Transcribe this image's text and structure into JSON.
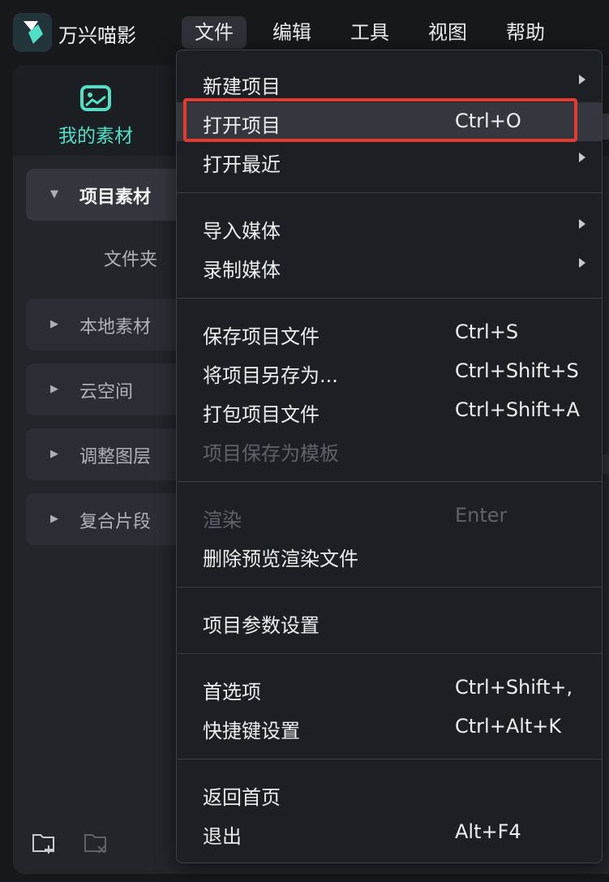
{
  "app": {
    "name": "万兴喵影"
  },
  "menubar": [
    {
      "label": "文件",
      "active": true
    },
    {
      "label": "编辑"
    },
    {
      "label": "工具"
    },
    {
      "label": "视图"
    },
    {
      "label": "帮助"
    }
  ],
  "left_panel": {
    "media_tab": "我的素材",
    "categories": [
      {
        "label": "项目素材"
      },
      {
        "label": "本地素材"
      },
      {
        "label": "云空间"
      },
      {
        "label": "调整图层"
      },
      {
        "label": "复合片段"
      }
    ],
    "subfolder": "文件夹"
  },
  "file_menu": {
    "items": [
      {
        "label": "新建项目",
        "submenu": true
      },
      {
        "label": "打开项目",
        "shortcut": "Ctrl+O",
        "highlighted": true
      },
      {
        "label": "打开最近",
        "submenu": true
      },
      {
        "label": "导入媒体",
        "submenu": true
      },
      {
        "label": "录制媒体",
        "submenu": true
      },
      {
        "label": "保存项目文件",
        "shortcut": "Ctrl+S"
      },
      {
        "label": "将项目另存为...",
        "shortcut": "Ctrl+Shift+S"
      },
      {
        "label": "打包项目文件",
        "shortcut": "Ctrl+Shift+A"
      },
      {
        "label": "项目保存为模板",
        "disabled": true
      },
      {
        "label": "渲染",
        "shortcut": "Enter",
        "disabled": true
      },
      {
        "label": "删除预览渲染文件"
      },
      {
        "label": "项目参数设置"
      },
      {
        "label": "首选项",
        "shortcut": "Ctrl+Shift+,"
      },
      {
        "label": "快捷键设置",
        "shortcut": "Ctrl+Alt+K"
      },
      {
        "label": "返回首页"
      },
      {
        "label": "退出",
        "shortcut": "Alt+F4"
      }
    ]
  },
  "colors": {
    "accent": "#4fe0c5",
    "highlight_box": "#e53a2f",
    "badge": "#ff8a5c"
  },
  "icons": [
    "app-logo-icon",
    "media-icon",
    "new-folder-icon",
    "delete-folder-icon",
    "submenu-arrow-icon"
  ]
}
